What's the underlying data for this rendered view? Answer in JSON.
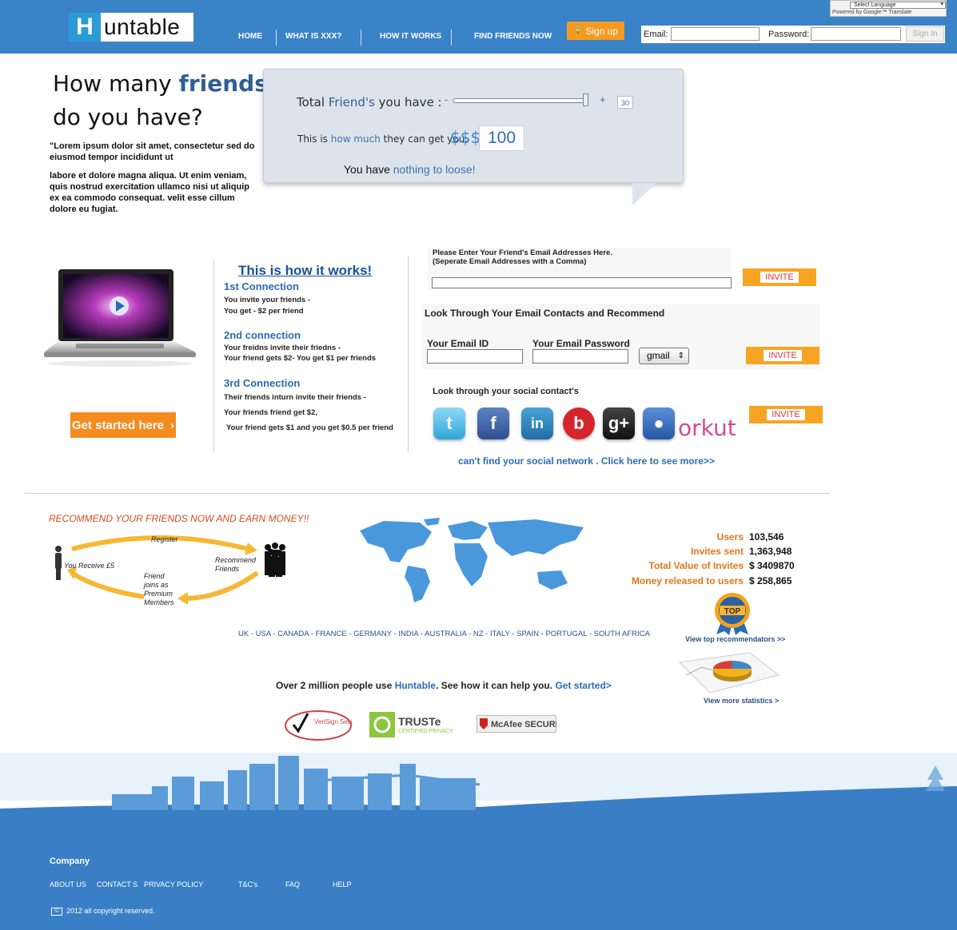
{
  "header": {
    "logo_letter": "H",
    "logo_text": "untable",
    "nav": [
      "HOME",
      "WHAT IS XXX?",
      "HOW IT WORKS",
      "FIND FRIENDS NOW"
    ],
    "signup_label": "Sign up",
    "email_label": "Email:",
    "password_label": "Password:",
    "signin_label": "Sign In",
    "language_select": "Select Language",
    "language_powered": "Powered by Google™ Translate"
  },
  "hero": {
    "title_part1": "How many ",
    "title_highlight": "friends",
    "title_part2": "do you have?",
    "lorem1": "\"Lorem ipsum dolor sit amet, consectetur sed do eiusmod tempor incididunt ut",
    "lorem2": "labore et dolore magna aliqua. Ut enim veniam, quis nostrud exercitation ullamco nisi ut aliquip ex ea commodo consequat. velit esse cillum dolore eu fugiat."
  },
  "calculator": {
    "label1_a": "Total ",
    "label1_hl": "Friend's",
    "label1_b": " you have :",
    "slider_minus": "-",
    "slider_plus": "+",
    "slider_value": "30",
    "slider_fraction": 0.98,
    "label2_a": "This is ",
    "label2_hl": "how much",
    "label2_b": " they can get you:",
    "currency": "$$$",
    "amount": "100",
    "loose_a": "You have ",
    "loose_hl": "nothing to loose!"
  },
  "works": {
    "get_started": "Get started here",
    "title": "This is how it works!",
    "connections": [
      {
        "title": "1st Connection",
        "lines": [
          "You invite your friends -",
          "You get - $2 per friend"
        ]
      },
      {
        "title": "2nd connection",
        "lines": [
          "Your freidns invite their friedns -",
          "Your friend gets $2- You get $1 per friends"
        ]
      },
      {
        "title": "3rd Connection",
        "lines": [
          "Their friends inturn invite their friends -",
          "Your friends friend get $2,",
          "Your friend gets $1 and you get $0.5 per friend"
        ]
      }
    ]
  },
  "invite": {
    "email_instructions1": "Please Enter Your Friend's Email Addresses Here.",
    "email_instructions2": "(Seperate Email Addresses with a Comma)",
    "invite_label": "INVITE",
    "contacts_title": "Look Through Your Email Contacts and Recommend",
    "email_id_label": "Your Email ID",
    "email_password_label": "Your Email Password",
    "provider": "gmail",
    "social_title": "Look through your social contact's",
    "social": [
      "twitter",
      "facebook",
      "linkedin",
      "bebo",
      "google-plus",
      "myspace",
      "orkut"
    ],
    "orkut_label": "orkut",
    "cant_find": "can't find your social network . Click here to see more>>"
  },
  "earn": {
    "title": "RECOMMEND YOUR FRIENDS NOW AND EARN MONEY!!",
    "register": "Register",
    "you_receive": "You Receive £5",
    "recommend": "Recommend\nFriends",
    "friend_joins": "Friend\njoins as\nPremium\nMembers",
    "countries": "UK - USA - CANADA - FRANCE - GERMANY - INDIA - AUSTRALIA - NZ - ITALY - SPAIN - PORTUGAL - SOUTH AFRICA"
  },
  "stats": [
    {
      "label": "Users",
      "value": "103,546"
    },
    {
      "label": "Invites sent",
      "value": "1,363,948"
    },
    {
      "label": "Total Value of Invites",
      "value": "$ 3409870"
    },
    {
      "label": "Money released to users",
      "value": "$ 258,865"
    }
  ],
  "badges": {
    "top_label": "TOP",
    "top_link": "View top recommendators >>",
    "stats_link": "View more statistics >"
  },
  "promo": {
    "text_a": "Over 2 million people use ",
    "text_hl": "Huntable",
    "text_b": ". See how it can help you. ",
    "cta": "Get started>"
  },
  "seals": {
    "verisign": "VeriSign Secured",
    "truste": "TRUSTe",
    "truste_sub": "CERTIFIED PRIVACY",
    "mcafee": "McAfee SECURE"
  },
  "footer": {
    "company": "Company",
    "links": [
      "ABOUT US",
      "CONTACT S",
      "PRIVACY POLICY",
      "T&C's",
      "FAQ",
      "HELP"
    ],
    "copyright": "2012 all copyright reserved."
  },
  "colors": {
    "header_blue": "#3a83c8",
    "accent_orange": "#f58a1f",
    "link_blue": "#2a6bb5"
  }
}
